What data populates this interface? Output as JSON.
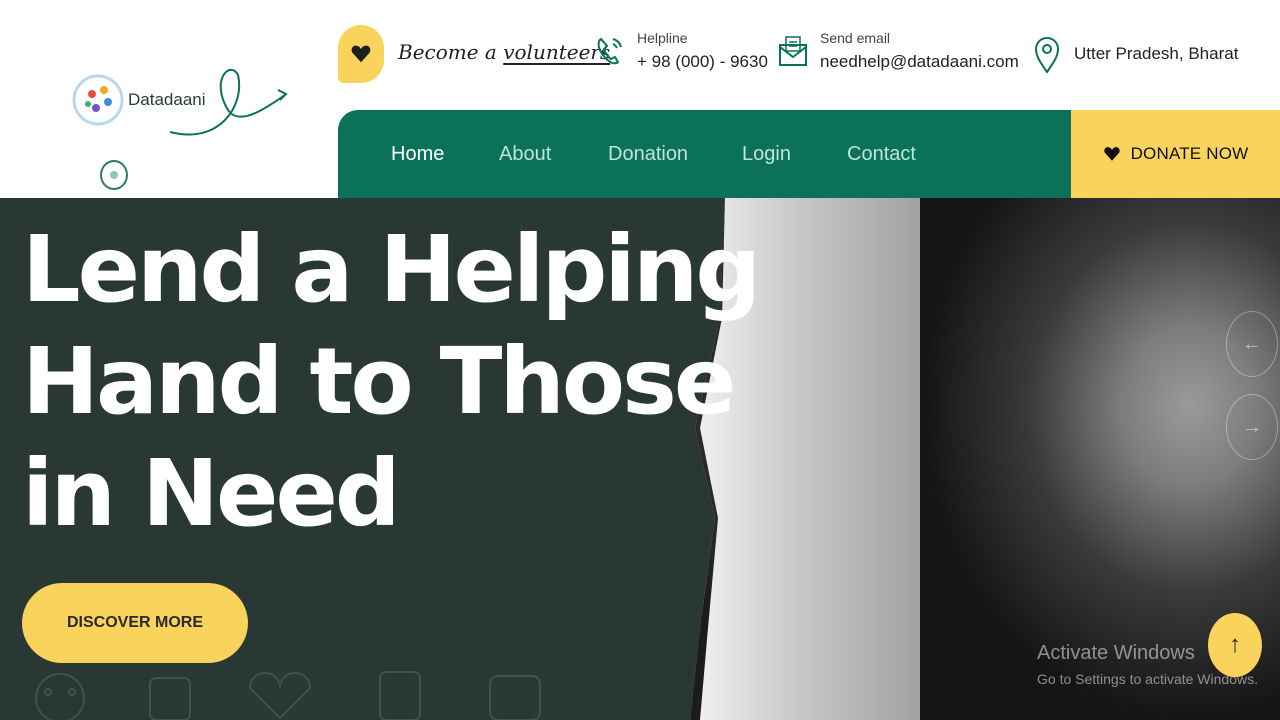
{
  "header": {
    "logo_text": "Datadaani",
    "volunteer": {
      "prefix": "Become a",
      "highlight": "volunteers"
    },
    "helpline": {
      "label": "Helpline",
      "value": "+ 98 (000) - 9630"
    },
    "email": {
      "label": "Send email",
      "value": "needhelp@datadaani.com"
    },
    "location": {
      "value": "Utter Pradesh, Bharat"
    }
  },
  "nav": {
    "items": [
      {
        "label": "Home",
        "active": true
      },
      {
        "label": "About"
      },
      {
        "label": "Donation"
      },
      {
        "label": "Login"
      },
      {
        "label": "Contact"
      }
    ],
    "donate_label": "DONATE NOW"
  },
  "hero": {
    "title_lines": [
      "Lend a Helping",
      "Hand to Those",
      "in Need"
    ],
    "cta_label": "DISCOVER MORE"
  },
  "slider": {
    "prev_icon": "arrow-left-icon",
    "next_icon": "arrow-right-icon",
    "prev_glyph": "←",
    "next_glyph": "→"
  },
  "scroll_top": {
    "glyph": "↑"
  },
  "watermark": {
    "line1": "Activate Windows",
    "line2": "Go to Settings to activate Windows."
  },
  "colors": {
    "primary": "#0b7259",
    "accent": "#f9d35b",
    "hero_bg": "#2a3834"
  }
}
